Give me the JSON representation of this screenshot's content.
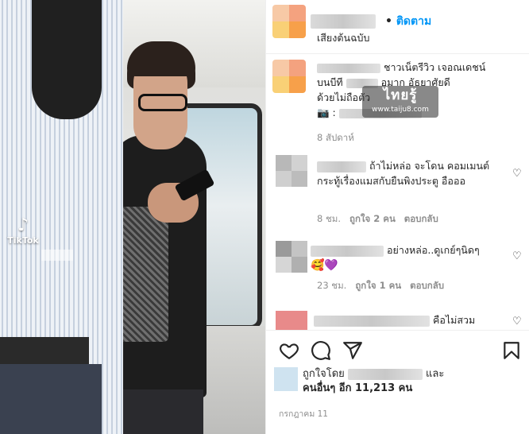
{
  "post": {
    "photo": {
      "tiktok_logo": "TikTok",
      "tiktok_icon": "tiktok-note-icon"
    },
    "header": {
      "follow_label": "ติดตาม",
      "separator": "•",
      "audio": "เสียงต้นฉบับ"
    },
    "caption": {
      "line1": "ชาวเน็ตรีวิว เจอณเดชน์",
      "line2_prefix": "บนบีที",
      "line2_suffix": "อมาก อัธยาศัยดี",
      "line3": "ด้วยไม่ถือตัว",
      "line4_prefix": "📷 :",
      "time": "8 สัปดาห์"
    },
    "comments": [
      {
        "text": "ถ้าไม่หล่อ จะโดน คอมเมนต์กระทู้เรื่องแมสกับยืนพิงประตู อือออ",
        "time": "8 ชม.",
        "likes": "ถูกใจ 2 คน",
        "reply": "ตอบกลับ"
      },
      {
        "text": "อย่างหล่อ..ดูเกย์ๆนิดๆ",
        "emoji": "🥰💜",
        "time": "23 ชม.",
        "likes": "ถูกใจ 1 คน",
        "reply": "ตอบกลับ"
      },
      {
        "text": "คือไม่สวม"
      }
    ],
    "actions": {
      "like_icon": "heart-icon",
      "comment_icon": "comment-icon",
      "share_icon": "share-icon",
      "save_icon": "bookmark-icon"
    },
    "likes": {
      "prefix": "ถูกใจโดย",
      "suffix": "และ",
      "line2": "คนอื่นๆ อีก 11,213 คน"
    },
    "date": "กรกฎาคม 11",
    "watermark": {
      "brand": "ไทยรู้",
      "url": "www.taiju8.com"
    },
    "colors": {
      "link": "#0095f6",
      "meta": "#8e8e8e",
      "text": "#262626",
      "divider": "#efefef"
    }
  }
}
